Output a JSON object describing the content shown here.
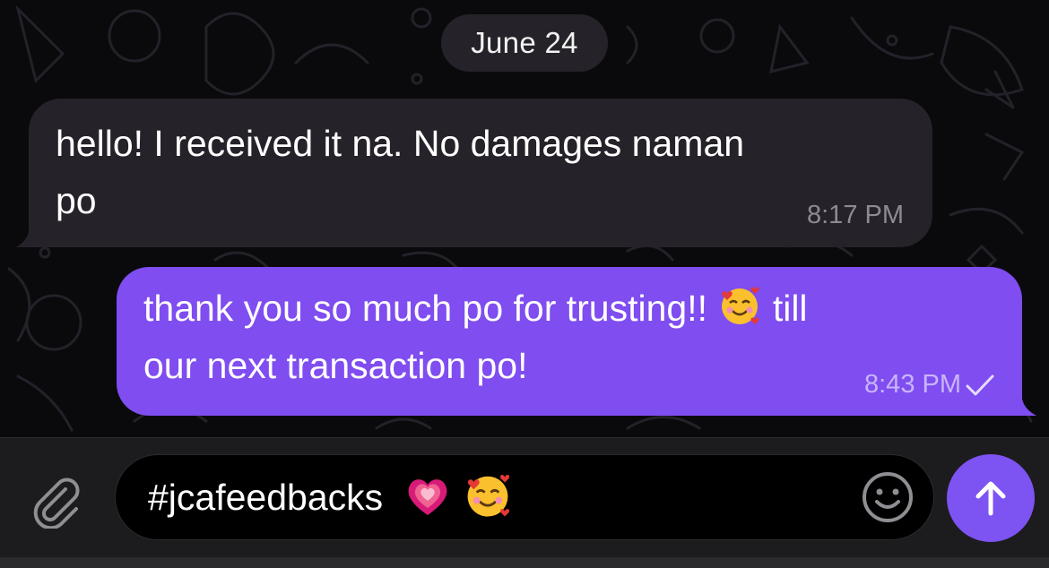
{
  "chat": {
    "date_separator": "June 24",
    "messages": [
      {
        "direction": "incoming",
        "line1": "hello! I received it na. No damages naman",
        "line2": "po",
        "time": "8:17 PM"
      },
      {
        "direction": "outgoing",
        "line1_before_emoji": "thank you so much po for trusting!!",
        "line1_emoji": "smiling-face-with-hearts",
        "line1_after_emoji": "till",
        "line2": "our next transaction po!",
        "time": "8:43 PM",
        "status": "sent-single-check"
      }
    ]
  },
  "composer": {
    "input_text": "#jcafeedbacks",
    "input_emojis": [
      "growing-heart",
      "smiling-face-with-hearts"
    ],
    "attach_icon": "paperclip-icon",
    "sticker_icon": "smiley-outline-icon",
    "send_icon": "arrow-up-icon"
  },
  "colors": {
    "background": "#0a0a0c",
    "incoming_bubble": "#262229",
    "outgoing_bubble": "#7f4df0",
    "send_button": "#7d53f2",
    "composer_bar": "#1c1c1e"
  }
}
